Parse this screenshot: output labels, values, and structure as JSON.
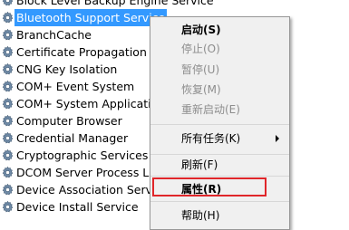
{
  "services": [
    {
      "name": "Block Level Backup Engine Service",
      "selected": false
    },
    {
      "name": "Bluetooth Support Service",
      "selected": true
    },
    {
      "name": "BranchCache",
      "selected": false
    },
    {
      "name": "Certificate Propagation",
      "selected": false
    },
    {
      "name": "CNG Key Isolation",
      "selected": false
    },
    {
      "name": "COM+ Event System",
      "selected": false
    },
    {
      "name": "COM+ System Application",
      "selected": false
    },
    {
      "name": "Computer Browser",
      "selected": false
    },
    {
      "name": "Credential Manager",
      "selected": false
    },
    {
      "name": "Cryptographic Services",
      "selected": false
    },
    {
      "name": "DCOM Server Process Launcher",
      "selected": false
    },
    {
      "name": "Device Association Service",
      "selected": false
    },
    {
      "name": "Device Install Service",
      "selected": false
    }
  ],
  "context_menu": {
    "start": "启动(S)",
    "stop": "停止(O)",
    "pause": "暂停(U)",
    "resume": "恢复(M)",
    "restart": "重新启动(E)",
    "all_tasks": "所有任务(K)",
    "refresh": "刷新(F)",
    "properties": "属性(R)",
    "help": "帮助(H)"
  },
  "colors": {
    "selection": "#3399ff",
    "highlight_box": "#e0262a",
    "menu_background": "#f0f0f0",
    "disabled_text": "#8d8d8d"
  }
}
